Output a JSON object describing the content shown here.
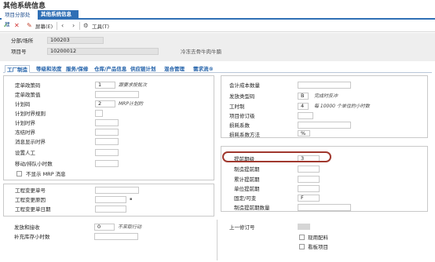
{
  "window": {
    "title": "其他系统信息"
  },
  "top_tabs": [
    {
      "label": "项目分部处理"
    },
    {
      "label": "其他系统信息"
    }
  ],
  "toolbar": {
    "screen_label": "屏幕(E)",
    "tools_label": "工具(T)"
  },
  "header": {
    "branch_label": "分部/场所",
    "branch_value": "100203",
    "item_label": "项目号",
    "item_value": "10200012",
    "item_desc": "冷冻去骨牛肉牛腩"
  },
  "tabs": [
    {
      "label": "工厂制造"
    },
    {
      "label": "等级和浓度"
    },
    {
      "label": "服务/保修"
    },
    {
      "label": "仓库/产品信息"
    },
    {
      "label": "供应链计划"
    },
    {
      "label": "混合管理"
    },
    {
      "label": "需求流®"
    }
  ],
  "left_panel": {
    "order_policy_code": {
      "label": "定单政策码",
      "value": "1",
      "hint": "跟要求按批次"
    },
    "order_policy_value": {
      "label": "定单政策值",
      "value": ""
    },
    "planning_code": {
      "label": "计划码",
      "value": "2",
      "hint": "MRP计划的"
    },
    "planning_time_fence_rule": {
      "label": "计划时界规则",
      "value": ""
    },
    "planning_time_fence": {
      "label": "计划时界",
      "value": ""
    },
    "freeze_time_fence": {
      "label": "冻结时界",
      "value": ""
    },
    "message_display_fence": {
      "label": "消息显示时界",
      "value": ""
    },
    "setup_labor": {
      "label": "设置人工",
      "value": ""
    },
    "move_queue_hours": {
      "label": "移动/排队小时数",
      "value": ""
    },
    "no_mrp_messages": {
      "label": "不显示 MRP 消息"
    }
  },
  "right_panel": {
    "acc_cost_qty": {
      "label": "会计成本数量",
      "value": ""
    },
    "issue_type_code": {
      "label": "发放类型码",
      "value": "B",
      "hint": "完成时反冲"
    },
    "work_hours": {
      "label": "工时制",
      "value": "4",
      "hint": "每 10000 个单位的小时数"
    },
    "item_revision_level": {
      "label": "项目修订级",
      "value": ""
    },
    "scrap_factor": {
      "label": "损耗系数",
      "value": ""
    },
    "scrap_method": {
      "label": "损耗系数方法",
      "value": "%"
    }
  },
  "leadtime_panel": {
    "leadtime_level": {
      "label": "提前期级",
      "value": "3"
    },
    "mfg_leadtime": {
      "label": "制造提前期",
      "value": ""
    },
    "cum_leadtime": {
      "label": "累计提前期",
      "value": ""
    },
    "unit_leadtime": {
      "label": "单位提前期",
      "value": ""
    },
    "fixed_variable": {
      "label": "固定/可变",
      "value": "F"
    },
    "mfg_leadtime_qty": {
      "label": "制造提前期数量",
      "value": ""
    }
  },
  "eng_panel": {
    "ecn_number": {
      "label": "工程变更单号",
      "value": ""
    },
    "ecn_reason": {
      "label": "工程变更原因",
      "value": ""
    },
    "ecn_date": {
      "label": "工程变更单日期",
      "value": ""
    }
  },
  "bottom": {
    "issue_receipt": {
      "label": "发放和接收",
      "value": "0",
      "hint": "不采取行动"
    },
    "replenish_hours": {
      "label": "补充库存小时数",
      "value": ""
    },
    "last_revision_no": {
      "label": "上一修订号"
    },
    "existing_config": {
      "label": "现用配料"
    },
    "kanban_item": {
      "label": "看板项目"
    }
  }
}
